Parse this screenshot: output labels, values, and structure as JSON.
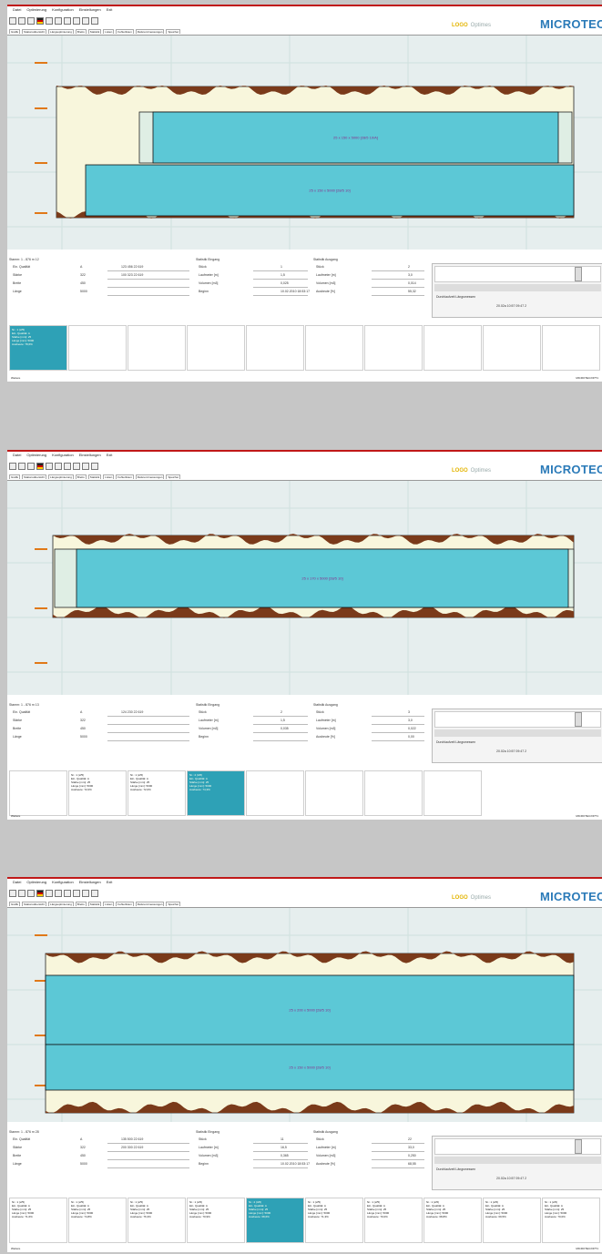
{
  "menu": [
    "Datei",
    "Optimierung",
    "Konfiguration",
    "Einstellungen",
    "Exit"
  ],
  "tabs": [
    "Grafik",
    "Stationsübersicht",
    "Längsoptimierung",
    "Bretts",
    "Statistik",
    "Listen",
    "Fehlerlisten",
    "Referenzmessungen",
    "Speicher"
  ],
  "branding": {
    "optimes_prefix": "LOGO",
    "optimes": "Optimes",
    "microtec": "MICROTEC"
  },
  "screens": [
    {
      "plot_label_main": "25 x 150 x 5000 [28/5 10/A]",
      "plot_label_second": "25 x 150 x 5000 [28/5 10]",
      "stamm": "Stamm: 1 - 876 m 12",
      "left_rows": [
        [
          "Ein. Qualität",
          "A",
          "123 456 22 619"
        ],
        [
          "Stärke",
          "322",
          "100 323 22 619"
        ],
        [
          "Breite",
          "450",
          ""
        ],
        [
          "Länge",
          "5000",
          ""
        ]
      ],
      "mid_title": "Statistik Eingang",
      "mid_rows": [
        [
          "Stück",
          "1"
        ],
        [
          "Laufmeter [m]",
          "1,5"
        ],
        [
          "Volumen [m3]",
          "0,025"
        ],
        [
          "Beginn",
          "10.02.2010 18:53:17"
        ]
      ],
      "right_title": "Statistik Ausgang",
      "right_rows": [
        [
          "Stück",
          "2"
        ],
        [
          "Laufmeter [m]",
          "3,0"
        ],
        [
          "Volumen [m3]",
          "0,014"
        ],
        [
          "Ausbeute [%]",
          "55,32"
        ]
      ],
      "panel_caption": "Durchlaufzeit Längsmessen",
      "panel_date": "20.02a 10:57 09:47 2",
      "cards": [
        {
          "active": true,
          "lines": [
            "Nr.: 1 (2/5)",
            "Ein. Qualität: A",
            "Stärke [mm]: 25",
            "Länge [mm]: 5000",
            "Ausbeute: 78,6%"
          ]
        },
        {
          "active": false,
          "lines": []
        },
        {
          "active": false,
          "lines": []
        },
        {
          "active": false,
          "lines": []
        },
        {
          "active": false,
          "lines": []
        },
        {
          "active": false,
          "lines": []
        },
        {
          "active": false,
          "lines": []
        },
        {
          "active": false,
          "lines": []
        },
        {
          "active": false,
          "lines": []
        },
        {
          "active": false,
          "lines": []
        }
      ],
      "status_left": "Weitere",
      "status_right": "MICROTEC/OPT1"
    },
    {
      "plot_label_main": "25 x 170 x 5000 [28/5 10]",
      "stamm": "Stamm: 1 - 876 m 13",
      "left_rows": [
        [
          "Ein. Qualität",
          "A",
          "124 230 22 619"
        ],
        [
          "Stärke",
          "322",
          ""
        ],
        [
          "Breite",
          "450",
          ""
        ],
        [
          "Länge",
          "5000",
          ""
        ]
      ],
      "mid_title": "Statistik Eingang",
      "mid_rows": [
        [
          "Stück",
          "2"
        ],
        [
          "Laufmeter [m]",
          "1,5"
        ],
        [
          "Volumen [m3]",
          "0,035"
        ],
        [
          "Beginn",
          ""
        ]
      ],
      "right_title": "Statistik Ausgang",
      "right_rows": [
        [
          "Stück",
          "3"
        ],
        [
          "Laufmeter [m]",
          "3,0"
        ],
        [
          "Volumen [m3]",
          "0,022"
        ],
        [
          "Ausbeute [%]",
          "0,00"
        ]
      ],
      "panel_caption": "Durchlaufzeit Längsmessen",
      "panel_date": "20.02a 10:57 09:47 2",
      "cards": [
        {
          "active": false,
          "lines": [
            "",
            "",
            "",
            "",
            ""
          ]
        },
        {
          "active": false,
          "lines": [
            "Nr.: 1 (2/5)",
            "Ein. Qualität: A",
            "Stärke [mm]: 25",
            "Länge [mm]: 5000",
            "Ausbeute: 72,0%"
          ]
        },
        {
          "active": false,
          "lines": [
            "Nr.: 1 (2/6)",
            "Ein. Qualität: A",
            "Stärke [mm]: 25",
            "Länge [mm]: 5000",
            "Ausbeute: 72,0%"
          ]
        },
        {
          "active": true,
          "lines": [
            "Nr.: 2 (3/6)",
            "Ein. Qualität: A",
            "Stärke [mm]: 25",
            "Länge [mm]: 5000",
            "Ausbeute: 74,3%"
          ]
        },
        {
          "active": false,
          "lines": []
        },
        {
          "active": false,
          "lines": []
        },
        {
          "active": false,
          "lines": []
        },
        {
          "active": false,
          "lines": []
        }
      ],
      "status_left": "Weitere",
      "status_right": "MICROTEC/OPT1"
    },
    {
      "plot_label_main": "25 x 200 x 5000 [28/5 10]",
      "plot_label_second": "25 x 150 x 5000 [28/5 10]",
      "stamm": "Stamm: 1 - 876 m 28",
      "left_rows": [
        [
          "Ein. Qualität",
          "A",
          "135 500 22 619"
        ],
        [
          "Stärke",
          "322",
          "200 300 22 619"
        ],
        [
          "Breite",
          "450",
          ""
        ],
        [
          "Länge",
          "5000",
          ""
        ]
      ],
      "mid_title": "Statistik Eingang",
      "mid_rows": [
        [
          "Stück",
          "11"
        ],
        [
          "Laufmeter [m]",
          "16,5"
        ],
        [
          "Volumen [m3]",
          "0,365"
        ],
        [
          "Beginn",
          "10.02.2010 18:53:17"
        ]
      ],
      "right_title": "Statistik Ausgang",
      "right_rows": [
        [
          "Stück",
          "22"
        ],
        [
          "Laufmeter [m]",
          "33,0"
        ],
        [
          "Volumen [m3]",
          "0,250"
        ],
        [
          "Ausbeute [%]",
          "68,55"
        ]
      ],
      "panel_caption": "Durchlaufzeit Längsmessen",
      "panel_date": "20.02a 10:57 09:47 2",
      "cards": [
        {
          "active": false,
          "lines": [
            "Nr.: 1 (2/5)",
            "Ein. Qualität: A",
            "Stärke [mm]: 25",
            "Länge [mm]: 5000",
            "Ausbeute: 71,6%"
          ]
        },
        {
          "active": false,
          "lines": [
            "Nr.: 1 (2/5)",
            "Ein. Qualität: A",
            "Stärke [mm]: 25",
            "Länge [mm]: 5000",
            "Ausbeute: 74,8%"
          ]
        },
        {
          "active": false,
          "lines": [
            "Nr.: 1 (2/5)",
            "Ein. Qualität: A",
            "Stärke [mm]: 25",
            "Länge [mm]: 5000",
            "Ausbeute: 76,3%"
          ]
        },
        {
          "active": false,
          "lines": [
            "Nr.: 1 (2/6)",
            "Ein. Qualität: A",
            "Stärke [mm]: 25",
            "Länge [mm]: 5000",
            "Ausbeute: 70,9%"
          ]
        },
        {
          "active": true,
          "lines": [
            "Nr.: 2 (3/6)",
            "Ein. Qualität: A",
            "Stärke [mm]: 25",
            "Länge [mm]: 5000",
            "Ausbeute: 68,6%"
          ]
        },
        {
          "active": false,
          "lines": [
            "Nr.: 1 (2/5)",
            "Ein. Qualität: A",
            "Stärke [mm]: 25",
            "Länge [mm]: 5000",
            "Ausbeute: 71,3%"
          ]
        },
        {
          "active": false,
          "lines": [
            "Nr.: 1 (2/5)",
            "Ein. Qualität: A",
            "Stärke [mm]: 25",
            "Länge [mm]: 5000",
            "Ausbeute: 70,0%"
          ]
        },
        {
          "active": false,
          "lines": [
            "Nr.: 1 (2/6)",
            "Ein. Qualität: A",
            "Stärke [mm]: 25",
            "Länge [mm]: 5000",
            "Ausbeute: 68,8%"
          ]
        },
        {
          "active": false,
          "lines": [
            "Nr.: 1 (2/6)",
            "Ein. Qualität: A",
            "Stärke [mm]: 25",
            "Länge [mm]: 5000",
            "Ausbeute: 69,5%"
          ]
        },
        {
          "active": false,
          "lines": [
            "Nr.: 1 (2/6)",
            "Ein. Qualität: A",
            "Stärke [mm]: 25",
            "Länge [mm]: 5000",
            "Ausbeute: 70,0%"
          ]
        }
      ],
      "status_left": "Weitere",
      "status_right": "MICROTEC/OPT1"
    }
  ],
  "colors": {
    "board": "#5cc8d6",
    "bark": "#7a3a1a",
    "wood": "#f8f6dc",
    "grid": "#cfe0de",
    "menu_accent": "#c01818",
    "marker": "#e07818",
    "card_active": "#2ea1b6"
  }
}
